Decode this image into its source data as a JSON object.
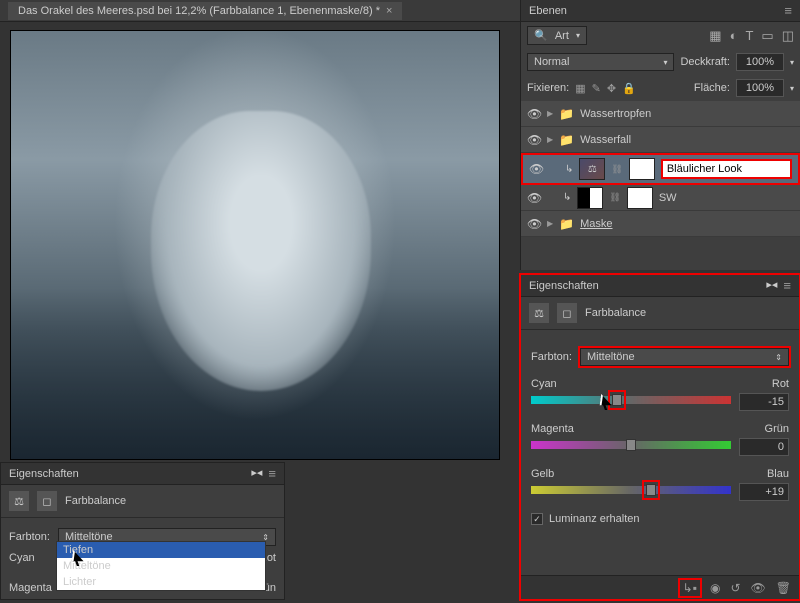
{
  "tab": {
    "title": "Das Orakel des Meeres.psd bei 12,2% (Farbbalance 1, Ebenenmaske/8) *"
  },
  "layers_panel": {
    "title": "Ebenen",
    "kind_label": "Art",
    "blend_mode": "Normal",
    "opacity_label": "Deckkraft:",
    "opacity_value": "100%",
    "lock_label": "Fixieren:",
    "fill_label": "Fläche:",
    "fill_value": "100%",
    "layers": [
      {
        "name": "Wassertropfen",
        "type": "group"
      },
      {
        "name": "Wasserfall",
        "type": "group"
      },
      {
        "name": "Bläulicher Look",
        "type": "adj",
        "editing": true
      },
      {
        "name": "SW",
        "type": "adj"
      },
      {
        "name": "Maske",
        "type": "group",
        "underline": true
      }
    ]
  },
  "props_panel": {
    "title": "Eigenschaften",
    "adj_name": "Farbbalance",
    "tone_label": "Farbton:",
    "tone_value": "Mitteltöne",
    "sliders": [
      {
        "left": "Cyan",
        "right": "Rot",
        "value": "-15",
        "pos": 43,
        "boxed": true
      },
      {
        "left": "Magenta",
        "right": "Grün",
        "value": "0",
        "pos": 50,
        "boxed": false
      },
      {
        "left": "Gelb",
        "right": "Blau",
        "value": "+19",
        "pos": 60,
        "boxed": true
      }
    ],
    "lum_label": "Luminanz erhalten",
    "lum_checked": true
  },
  "mini_props": {
    "title": "Eigenschaften",
    "adj_name": "Farbbalance",
    "tone_label": "Farbton:",
    "tone_value": "Mitteltöne",
    "slider1_left": "Cyan",
    "slider1_right": "Rot",
    "slider2_left": "Magenta",
    "slider2_right": "Grün",
    "options": [
      "Tiefen",
      "Mitteltöne",
      "Lichter"
    ],
    "selected": "Tiefen"
  }
}
